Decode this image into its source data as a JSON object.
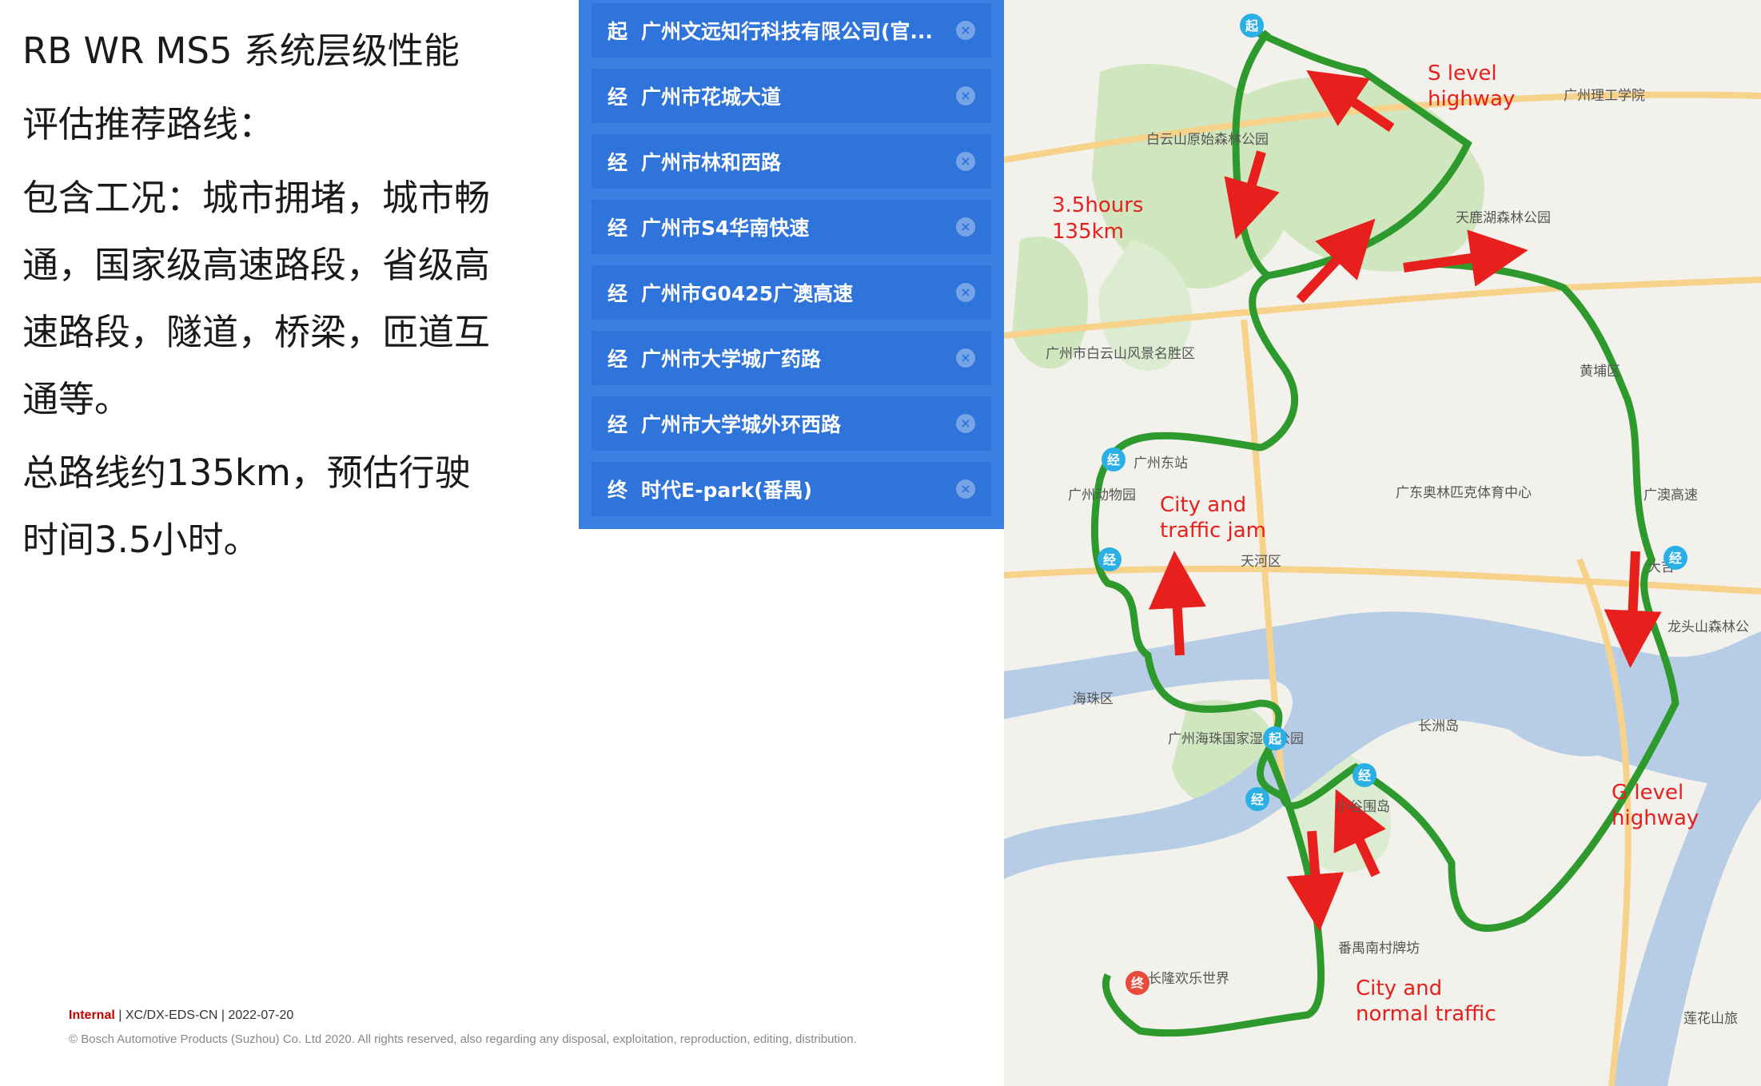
{
  "left": {
    "title_line1": "RB WR MS5 系统层级性能",
    "title_line2": "评估推荐路线：",
    "conditions": "包含工况：城市拥堵，城市畅通，国家级高速路段，省级高速路段，隧道，桥梁，匝道互通等。",
    "summary": "总路线约135km，预估行驶时间3.5小时。"
  },
  "footer": {
    "internal": "Internal",
    "info": " | XC/DX-EDS-CN | 2022-07-20",
    "copyright": "© Bosch Automotive Products (Suzhou) Co. Ltd  2020. All rights reserved, also regarding any disposal, exploitation, reproduction, editing, distribution."
  },
  "route": {
    "items": [
      {
        "tag": "起",
        "name": "广州文远知行科技有限公司(官..."
      },
      {
        "tag": "经",
        "name": "广州市花城大道"
      },
      {
        "tag": "经",
        "name": "广州市林和西路"
      },
      {
        "tag": "经",
        "name": "广州市S4华南快速"
      },
      {
        "tag": "经",
        "name": "广州市G0425广澳高速"
      },
      {
        "tag": "经",
        "name": "广州市大学城广药路"
      },
      {
        "tag": "经",
        "name": "广州市大学城外环西路"
      },
      {
        "tag": "终",
        "name": "时代E-park(番禺)"
      }
    ],
    "close_icon": "×"
  },
  "map": {
    "annotations": {
      "s_level": [
        "S level",
        "highway"
      ],
      "duration": [
        "3.5hours",
        "135km"
      ],
      "city_jam": [
        "City and",
        "traffic jam"
      ],
      "g_level": [
        "G level",
        "highway"
      ],
      "city_normal": [
        "City and",
        "normal traffic"
      ]
    },
    "places": {
      "gz_ligong": "广州理工学院",
      "baiyunshan_forest": "白云山原始森林公园",
      "tianluhu": "天鹿湖森林公园",
      "baiyunshan_scenic": "广州市白云山风景名胜区",
      "gz_east": "广州东站",
      "gz_zoo": "广州动物园",
      "olympic": "广东奥林匹克体育中心",
      "tianhe": "天河区",
      "haizhu": "海珠区",
      "haizhu_wetland": "广州海珠国家湿地公园",
      "changzhou": "长洲岛",
      "xiaoguwei": "小谷围岛",
      "longtoushan": "龙头山森林公",
      "panyu_nancun": "番禺南村牌坊",
      "chimelong": "长隆欢乐世界",
      "lianhuashan": "莲花山旅",
      "huangpu": "黄埔区",
      "dadong": "大吉",
      "gangao": "广澳高速"
    },
    "pins": {
      "start": "起",
      "via": "经",
      "end": "终"
    },
    "colors": {
      "route": "#2e9a2e",
      "arrow": "#e8201d",
      "water": "#b7cde6",
      "green": "#cfe6bf",
      "land": "#f3f1ec"
    }
  }
}
